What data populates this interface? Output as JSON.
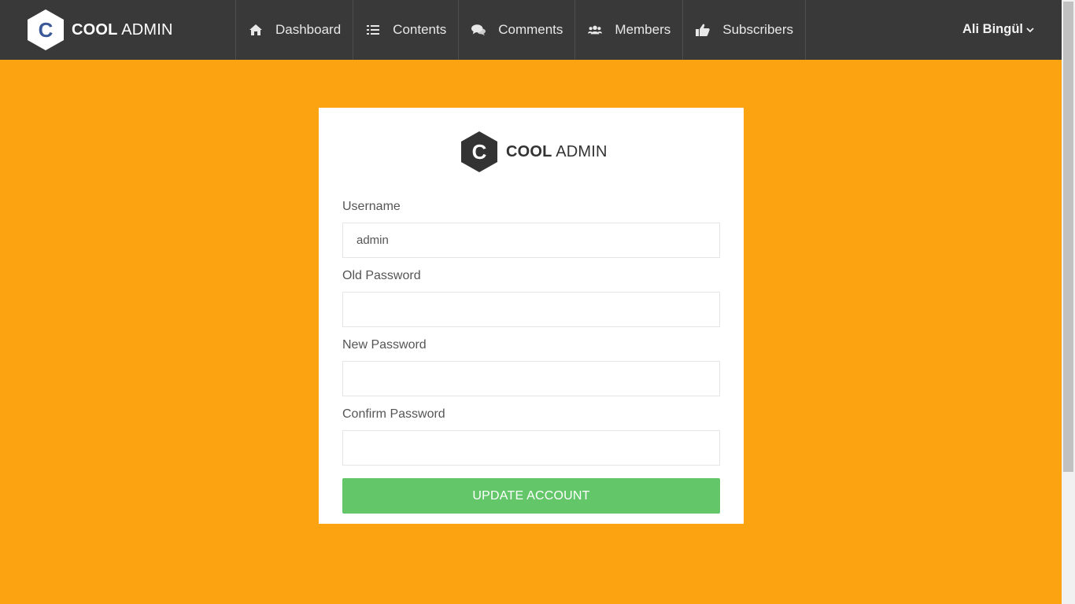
{
  "brand": {
    "bold": "COOL",
    "light": "ADMIN",
    "logo_letter": "C"
  },
  "nav": [
    {
      "label": "Dashboard",
      "icon": "home-icon"
    },
    {
      "label": "Contents",
      "icon": "list-icon"
    },
    {
      "label": "Comments",
      "icon": "comments-icon"
    },
    {
      "label": "Members",
      "icon": "users-icon"
    },
    {
      "label": "Subscribers",
      "icon": "thumbs-up-icon"
    }
  ],
  "user": {
    "name": "Ali Bingül",
    "icon": "chevron-down-icon"
  },
  "form": {
    "username_label": "Username",
    "username_value": "admin",
    "old_password_label": "Old Password",
    "new_password_label": "New Password",
    "confirm_password_label": "Confirm Password",
    "submit_label": "UPDATE ACCOUNT"
  },
  "colors": {
    "header_bg": "#393939",
    "page_bg": "#fca311",
    "button_bg": "#63c76a",
    "logo_accent": "#3b5998"
  }
}
